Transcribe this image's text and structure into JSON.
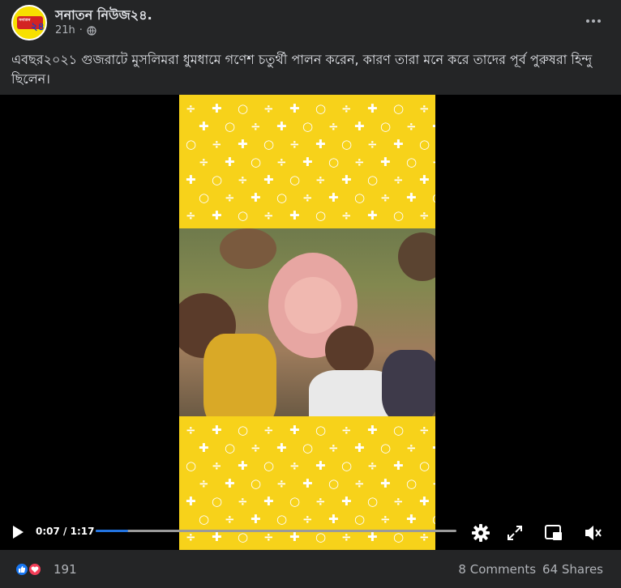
{
  "page": {
    "name": "সনাতন নিউজ২৪.",
    "time": "21h",
    "avatar_text": "২৪"
  },
  "post": {
    "caption": "এবছর২০২১ গুজরাটে মুসলিমরা ধুমধামে গণেশ চতুর্থী পালন করেন, কারণ তারা মনে করে তাদের পূর্ব পুরুষরা হিন্দু ছিলেন।"
  },
  "video": {
    "current_time": "0:07",
    "duration": "1:17",
    "progress_fraction": 0.09,
    "frame_color": "#f7d21a",
    "progress_color": "#2374e1"
  },
  "icons": {
    "more": "more-options-icon",
    "audience": "globe-icon",
    "play": "play-icon",
    "settings": "gear-icon",
    "fullscreen": "expand-icon",
    "pip": "picture-in-picture-icon",
    "mute": "muted-speaker-icon",
    "like": "like-icon",
    "love": "heart-icon"
  },
  "footer": {
    "reaction_count": "191",
    "comments": "8 Comments",
    "shares": "64 Shares"
  }
}
